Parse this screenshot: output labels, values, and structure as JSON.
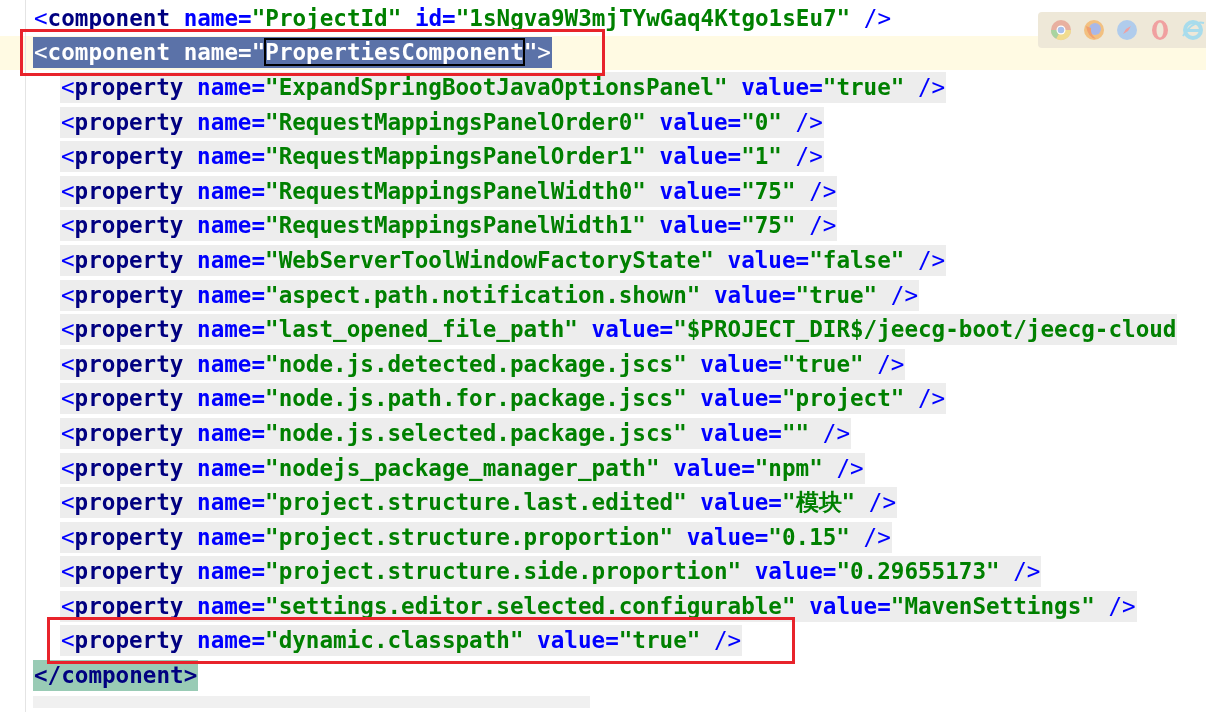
{
  "lines": [
    {
      "tokens": [
        {
          "kind": "bracket",
          "text": "<"
        },
        {
          "kind": "tag",
          "text": "component"
        },
        {
          "kind": "attr",
          "text": " name="
        },
        {
          "kind": "string",
          "text": "\"ProjectId\""
        },
        {
          "kind": "attr",
          "text": " id="
        },
        {
          "kind": "string",
          "text": "\"1sNgva9W3mjTYwGaq4Ktgo1sEu7\""
        },
        {
          "kind": "bracket",
          "text": " />"
        }
      ]
    },
    {
      "current": true,
      "selected": true,
      "annotated": true,
      "tokens": [
        {
          "kind": "bracket",
          "text": "<"
        },
        {
          "kind": "tag",
          "text": "component"
        },
        {
          "kind": "attr",
          "text": " name="
        },
        {
          "kind": "string",
          "text": "\""
        },
        {
          "kind": "string",
          "text": "PropertiesComponent",
          "found": true
        },
        {
          "kind": "string",
          "text": "\""
        },
        {
          "kind": "bracket",
          "text": ">"
        }
      ],
      "children": [
        {
          "tokens": [
            {
              "kind": "bracket",
              "text": "<"
            },
            {
              "kind": "tag",
              "text": "property"
            },
            {
              "kind": "attr",
              "text": " name="
            },
            {
              "kind": "string",
              "text": "\"ExpandSpringBootJavaOptionsPanel\""
            },
            {
              "kind": "attr",
              "text": " value="
            },
            {
              "kind": "string",
              "text": "\"true\""
            },
            {
              "kind": "bracket",
              "text": " />"
            }
          ]
        },
        {
          "tokens": [
            {
              "kind": "bracket",
              "text": "<"
            },
            {
              "kind": "tag",
              "text": "property"
            },
            {
              "kind": "attr",
              "text": " name="
            },
            {
              "kind": "string",
              "text": "\"RequestMappingsPanelOrder0\""
            },
            {
              "kind": "attr",
              "text": " value="
            },
            {
              "kind": "string",
              "text": "\"0\""
            },
            {
              "kind": "bracket",
              "text": " />"
            }
          ]
        },
        {
          "tokens": [
            {
              "kind": "bracket",
              "text": "<"
            },
            {
              "kind": "tag",
              "text": "property"
            },
            {
              "kind": "attr",
              "text": " name="
            },
            {
              "kind": "string",
              "text": "\"RequestMappingsPanelOrder1\""
            },
            {
              "kind": "attr",
              "text": " value="
            },
            {
              "kind": "string",
              "text": "\"1\""
            },
            {
              "kind": "bracket",
              "text": " />"
            }
          ]
        },
        {
          "tokens": [
            {
              "kind": "bracket",
              "text": "<"
            },
            {
              "kind": "tag",
              "text": "property"
            },
            {
              "kind": "attr",
              "text": " name="
            },
            {
              "kind": "string",
              "text": "\"RequestMappingsPanelWidth0\""
            },
            {
              "kind": "attr",
              "text": " value="
            },
            {
              "kind": "string",
              "text": "\"75\""
            },
            {
              "kind": "bracket",
              "text": " />"
            }
          ]
        },
        {
          "tokens": [
            {
              "kind": "bracket",
              "text": "<"
            },
            {
              "kind": "tag",
              "text": "property"
            },
            {
              "kind": "attr",
              "text": " name="
            },
            {
              "kind": "string",
              "text": "\"RequestMappingsPanelWidth1\""
            },
            {
              "kind": "attr",
              "text": " value="
            },
            {
              "kind": "string",
              "text": "\"75\""
            },
            {
              "kind": "bracket",
              "text": " />"
            }
          ]
        },
        {
          "tokens": [
            {
              "kind": "bracket",
              "text": "<"
            },
            {
              "kind": "tag",
              "text": "property"
            },
            {
              "kind": "attr",
              "text": " name="
            },
            {
              "kind": "string",
              "text": "\"WebServerToolWindowFactoryState\""
            },
            {
              "kind": "attr",
              "text": " value="
            },
            {
              "kind": "string",
              "text": "\"false\""
            },
            {
              "kind": "bracket",
              "text": " />"
            }
          ]
        },
        {
          "tokens": [
            {
              "kind": "bracket",
              "text": "<"
            },
            {
              "kind": "tag",
              "text": "property"
            },
            {
              "kind": "attr",
              "text": " name="
            },
            {
              "kind": "string",
              "text": "\"aspect.path.notification.shown\""
            },
            {
              "kind": "attr",
              "text": " value="
            },
            {
              "kind": "string",
              "text": "\"true\""
            },
            {
              "kind": "bracket",
              "text": " />"
            }
          ]
        },
        {
          "tokens": [
            {
              "kind": "bracket",
              "text": "<"
            },
            {
              "kind": "tag",
              "text": "property"
            },
            {
              "kind": "attr",
              "text": " name="
            },
            {
              "kind": "string",
              "text": "\"last_opened_file_path\""
            },
            {
              "kind": "attr",
              "text": " value="
            },
            {
              "kind": "string",
              "text": "\"$PROJECT_DIR$/jeecg-boot/jeecg-cloud"
            }
          ]
        },
        {
          "tokens": [
            {
              "kind": "bracket",
              "text": "<"
            },
            {
              "kind": "tag",
              "text": "property"
            },
            {
              "kind": "attr",
              "text": " name="
            },
            {
              "kind": "string",
              "text": "\"node.js.detected.package.jscs\""
            },
            {
              "kind": "attr",
              "text": " value="
            },
            {
              "kind": "string",
              "text": "\"true\""
            },
            {
              "kind": "bracket",
              "text": " />"
            }
          ]
        },
        {
          "tokens": [
            {
              "kind": "bracket",
              "text": "<"
            },
            {
              "kind": "tag",
              "text": "property"
            },
            {
              "kind": "attr",
              "text": " name="
            },
            {
              "kind": "string",
              "text": "\"node.js.path.for.package.jscs\""
            },
            {
              "kind": "attr",
              "text": " value="
            },
            {
              "kind": "string",
              "text": "\"project\""
            },
            {
              "kind": "bracket",
              "text": " />"
            }
          ]
        },
        {
          "tokens": [
            {
              "kind": "bracket",
              "text": "<"
            },
            {
              "kind": "tag",
              "text": "property"
            },
            {
              "kind": "attr",
              "text": " name="
            },
            {
              "kind": "string",
              "text": "\"node.js.selected.package.jscs\""
            },
            {
              "kind": "attr",
              "text": " value="
            },
            {
              "kind": "string",
              "text": "\"\""
            },
            {
              "kind": "bracket",
              "text": " />"
            }
          ]
        },
        {
          "tokens": [
            {
              "kind": "bracket",
              "text": "<"
            },
            {
              "kind": "tag",
              "text": "property"
            },
            {
              "kind": "attr",
              "text": " name="
            },
            {
              "kind": "string",
              "text": "\"nodejs_package_manager_path\""
            },
            {
              "kind": "attr",
              "text": " value="
            },
            {
              "kind": "string",
              "text": "\"npm\""
            },
            {
              "kind": "bracket",
              "text": " />"
            }
          ]
        },
        {
          "tokens": [
            {
              "kind": "bracket",
              "text": "<"
            },
            {
              "kind": "tag",
              "text": "property"
            },
            {
              "kind": "attr",
              "text": " name="
            },
            {
              "kind": "string",
              "text": "\"project.structure.last.edited\""
            },
            {
              "kind": "attr",
              "text": " value="
            },
            {
              "kind": "string",
              "text": "\"模块\""
            },
            {
              "kind": "bracket",
              "text": " />"
            }
          ]
        },
        {
          "tokens": [
            {
              "kind": "bracket",
              "text": "<"
            },
            {
              "kind": "tag",
              "text": "property"
            },
            {
              "kind": "attr",
              "text": " name="
            },
            {
              "kind": "string",
              "text": "\"project.structure.proportion\""
            },
            {
              "kind": "attr",
              "text": " value="
            },
            {
              "kind": "string",
              "text": "\"0.15\""
            },
            {
              "kind": "bracket",
              "text": " />"
            }
          ]
        },
        {
          "tokens": [
            {
              "kind": "bracket",
              "text": "<"
            },
            {
              "kind": "tag",
              "text": "property"
            },
            {
              "kind": "attr",
              "text": " name="
            },
            {
              "kind": "string",
              "text": "\"project.structure.side.proportion\""
            },
            {
              "kind": "attr",
              "text": " value="
            },
            {
              "kind": "string",
              "text": "\"0.29655173\""
            },
            {
              "kind": "bracket",
              "text": " />"
            }
          ]
        },
        {
          "tokens": [
            {
              "kind": "bracket",
              "text": "<"
            },
            {
              "kind": "tag",
              "text": "property"
            },
            {
              "kind": "attr",
              "text": " name="
            },
            {
              "kind": "string",
              "text": "\"settings.editor.selected.configurable\""
            },
            {
              "kind": "attr",
              "text": " value="
            },
            {
              "kind": "string",
              "text": "\"MavenSettings\""
            },
            {
              "kind": "bracket",
              "text": " />"
            }
          ]
        },
        {
          "annotated": true,
          "tokens": [
            {
              "kind": "bracket",
              "text": "<"
            },
            {
              "kind": "tag",
              "text": "property"
            },
            {
              "kind": "attr",
              "text": " name="
            },
            {
              "kind": "string",
              "text": "\"dynamic.classpath\""
            },
            {
              "kind": "attr",
              "text": " value="
            },
            {
              "kind": "string",
              "text": "\"true\""
            },
            {
              "kind": "bracket",
              "text": " />"
            }
          ]
        }
      ]
    },
    {
      "matched": true,
      "tokens": [
        {
          "kind": "tag",
          "text": "</component>"
        }
      ]
    }
  ]
}
